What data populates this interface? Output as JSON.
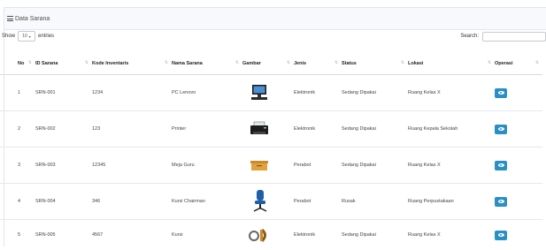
{
  "panel": {
    "title": "Data Sarana"
  },
  "controls": {
    "show_label": "Show",
    "entries_value": "10",
    "entries_label": "entries",
    "search_label": "Search:",
    "search_value": ""
  },
  "table": {
    "headers": [
      "No",
      "ID Sarana",
      "Kode Inventaris",
      "Nama Sarana",
      "Gambar",
      "Jenis",
      "Status",
      "Lokasi",
      "Operasi"
    ],
    "rows": [
      {
        "no": "1",
        "id": "SRN-001",
        "kode": "1234",
        "nama": "PC Lenovo",
        "gambar": "computer-image",
        "jenis": "Elektronik",
        "status": "Sedang Dipakai",
        "lokasi": "Ruang Kelas X"
      },
      {
        "no": "2",
        "id": "SRN-002",
        "kode": "123",
        "nama": "Printer",
        "gambar": "printer-image",
        "jenis": "Elektronik",
        "status": "Sedang Dipakai",
        "lokasi": "Ruang Kepala Sekolah"
      },
      {
        "no": "3",
        "id": "SRN-003",
        "kode": "12345",
        "nama": "Meja Guru",
        "gambar": "desk-image",
        "jenis": "Perabot",
        "status": "Sedang Dipakai",
        "lokasi": "Ruang Kelas X"
      },
      {
        "no": "4",
        "id": "SRN-004",
        "kode": "346",
        "nama": "Kursi Chairman",
        "gambar": "office-chair-image",
        "jenis": "Perabot",
        "status": "Rusak",
        "lokasi": "Ruang Perpustakaan"
      },
      {
        "no": "5",
        "id": "SRN-005",
        "kode": "4567",
        "nama": "Kursi",
        "gambar": "chair-image",
        "jenis": "Elektronik",
        "status": "Sedang Dipakai",
        "lokasi": "Ruang Kelas X"
      }
    ]
  },
  "colors": {
    "view_button": "#2a8fc4",
    "header_bg": "#f8f9fc",
    "border": "#e3e6f0"
  }
}
